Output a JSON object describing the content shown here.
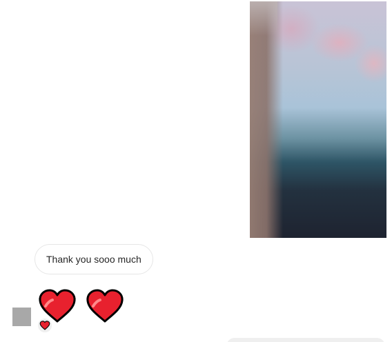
{
  "thread": {
    "shared_photo": {
      "description_icon": "blurred-photo-sky"
    },
    "received_message": {
      "text": "Thank you sooo much"
    },
    "emoji_message": {
      "emoji": [
        "red-heart",
        "red-heart"
      ]
    },
    "reaction": {
      "emoji": "red-heart"
    }
  },
  "colors": {
    "bubble_border": "#e6e6e6",
    "text": "#262626",
    "heart_red": "#e8212e",
    "heart_outline": "#000000",
    "avatar": "#a8a8a8",
    "reaction_bg": "#efefef"
  }
}
